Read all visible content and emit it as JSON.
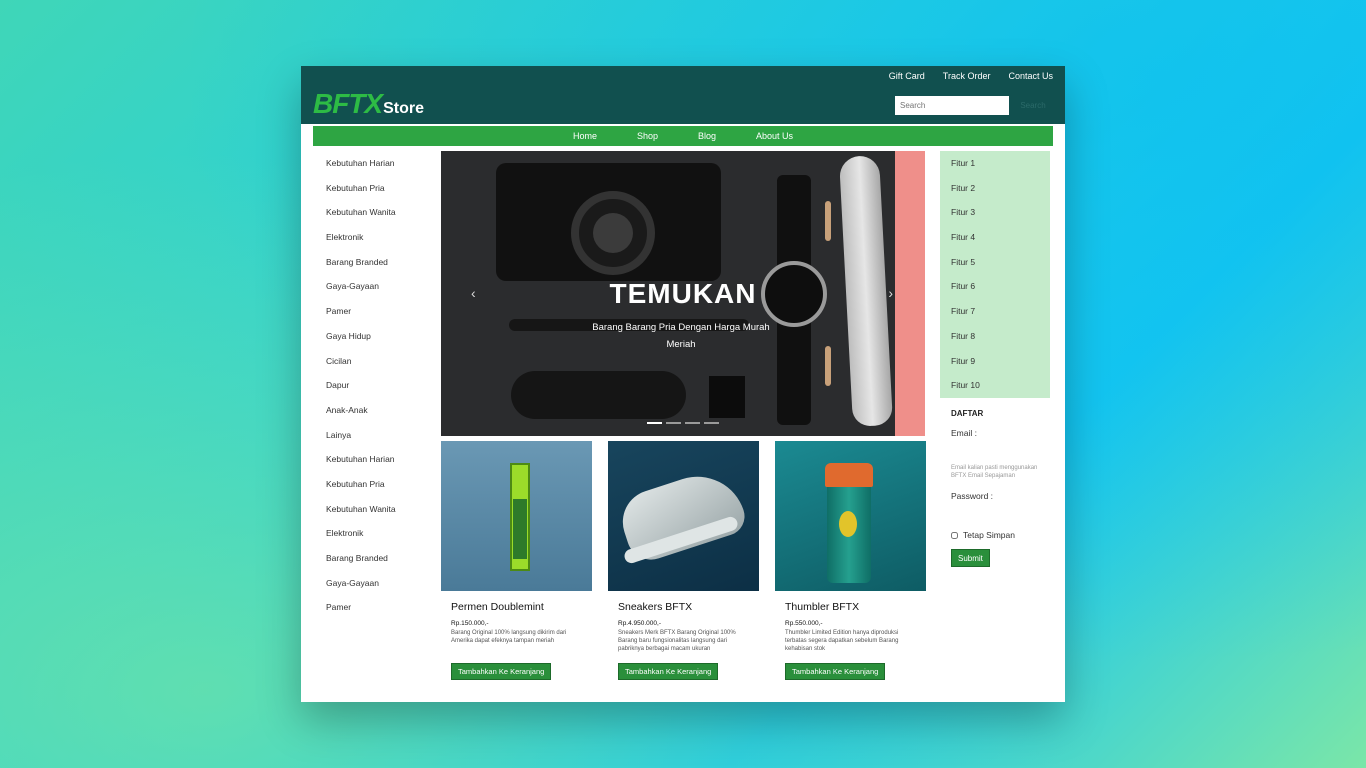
{
  "header": {
    "top_links": [
      "Gift Card",
      "Track Order",
      "Contact Us"
    ],
    "logo_bftx": "BFTX",
    "logo_store": "Store",
    "search_placeholder": "Search",
    "search_button": "Search"
  },
  "nav": [
    "Home",
    "Shop",
    "Blog",
    "About Us"
  ],
  "sidebar": [
    "Kebutuhan Harian",
    "Kebutuhan Pria",
    "Kebutuhan Wanita",
    "Elektronik",
    "Barang Branded",
    "Gaya-Gayaan",
    "Pamer",
    "Gaya Hidup",
    "Cicilan",
    "Dapur",
    "Anak-Anak",
    "Lainya",
    "Kebutuhan Harian",
    "Kebutuhan Pria",
    "Kebutuhan Wanita",
    "Elektronik",
    "Barang Branded",
    "Gaya-Gayaan",
    "Pamer"
  ],
  "hero": {
    "title": "TEMUKAN",
    "subtitle": "Barang Barang Pria Dengan Harga Murah Meriah",
    "prev_icon": "chevron-left-icon",
    "next_icon": "chevron-right-icon",
    "prev_glyph": "‹",
    "next_glyph": "›",
    "slides": 4,
    "active_slide": 1
  },
  "products": [
    {
      "name": "Permen Doublemint",
      "price": "Rp.150.000,-",
      "desc": "Barang Original 100% langsung dikirim dari Amerika dapat efeknya tampan meriah",
      "button": "Tambahkan Ke Keranjang"
    },
    {
      "name": "Sneakers BFTX",
      "price": "Rp.4.950.000,-",
      "desc": "Sneakers Merk BFTX Barang Original 100% Barang baru fungsionalitas langsung dari pabriknya berbagai macam ukuran",
      "button": "Tambahkan Ke Keranjang"
    },
    {
      "name": "Thumbler BFTX",
      "price": "Rp.550.000,-",
      "desc": "Thumbler Limited Edition hanya diproduksi terbatas segera dapatkan sebelum Barang kehabisan stok",
      "button": "Tambahkan Ke Keranjang"
    }
  ],
  "features": [
    "Fitur 1",
    "Fitur 2",
    "Fitur 3",
    "Fitur 4",
    "Fitur 5",
    "Fitur 6",
    "Fitur 7",
    "Fitur 8",
    "Fitur 9",
    "Fitur 10"
  ],
  "form": {
    "title": "DAFTAR",
    "email_label": "Email :",
    "help_text": "Email kalian pasti menggunakan BFTX Email Sepajaman",
    "password_label": "Password :",
    "remember_label": "Tetap Simpan",
    "submit": "Submit"
  },
  "colors": {
    "header_bg": "#11504f",
    "nav_bg": "#2ea543",
    "accent": "#2a8f3b",
    "features_bg": "#c5ebcb"
  }
}
